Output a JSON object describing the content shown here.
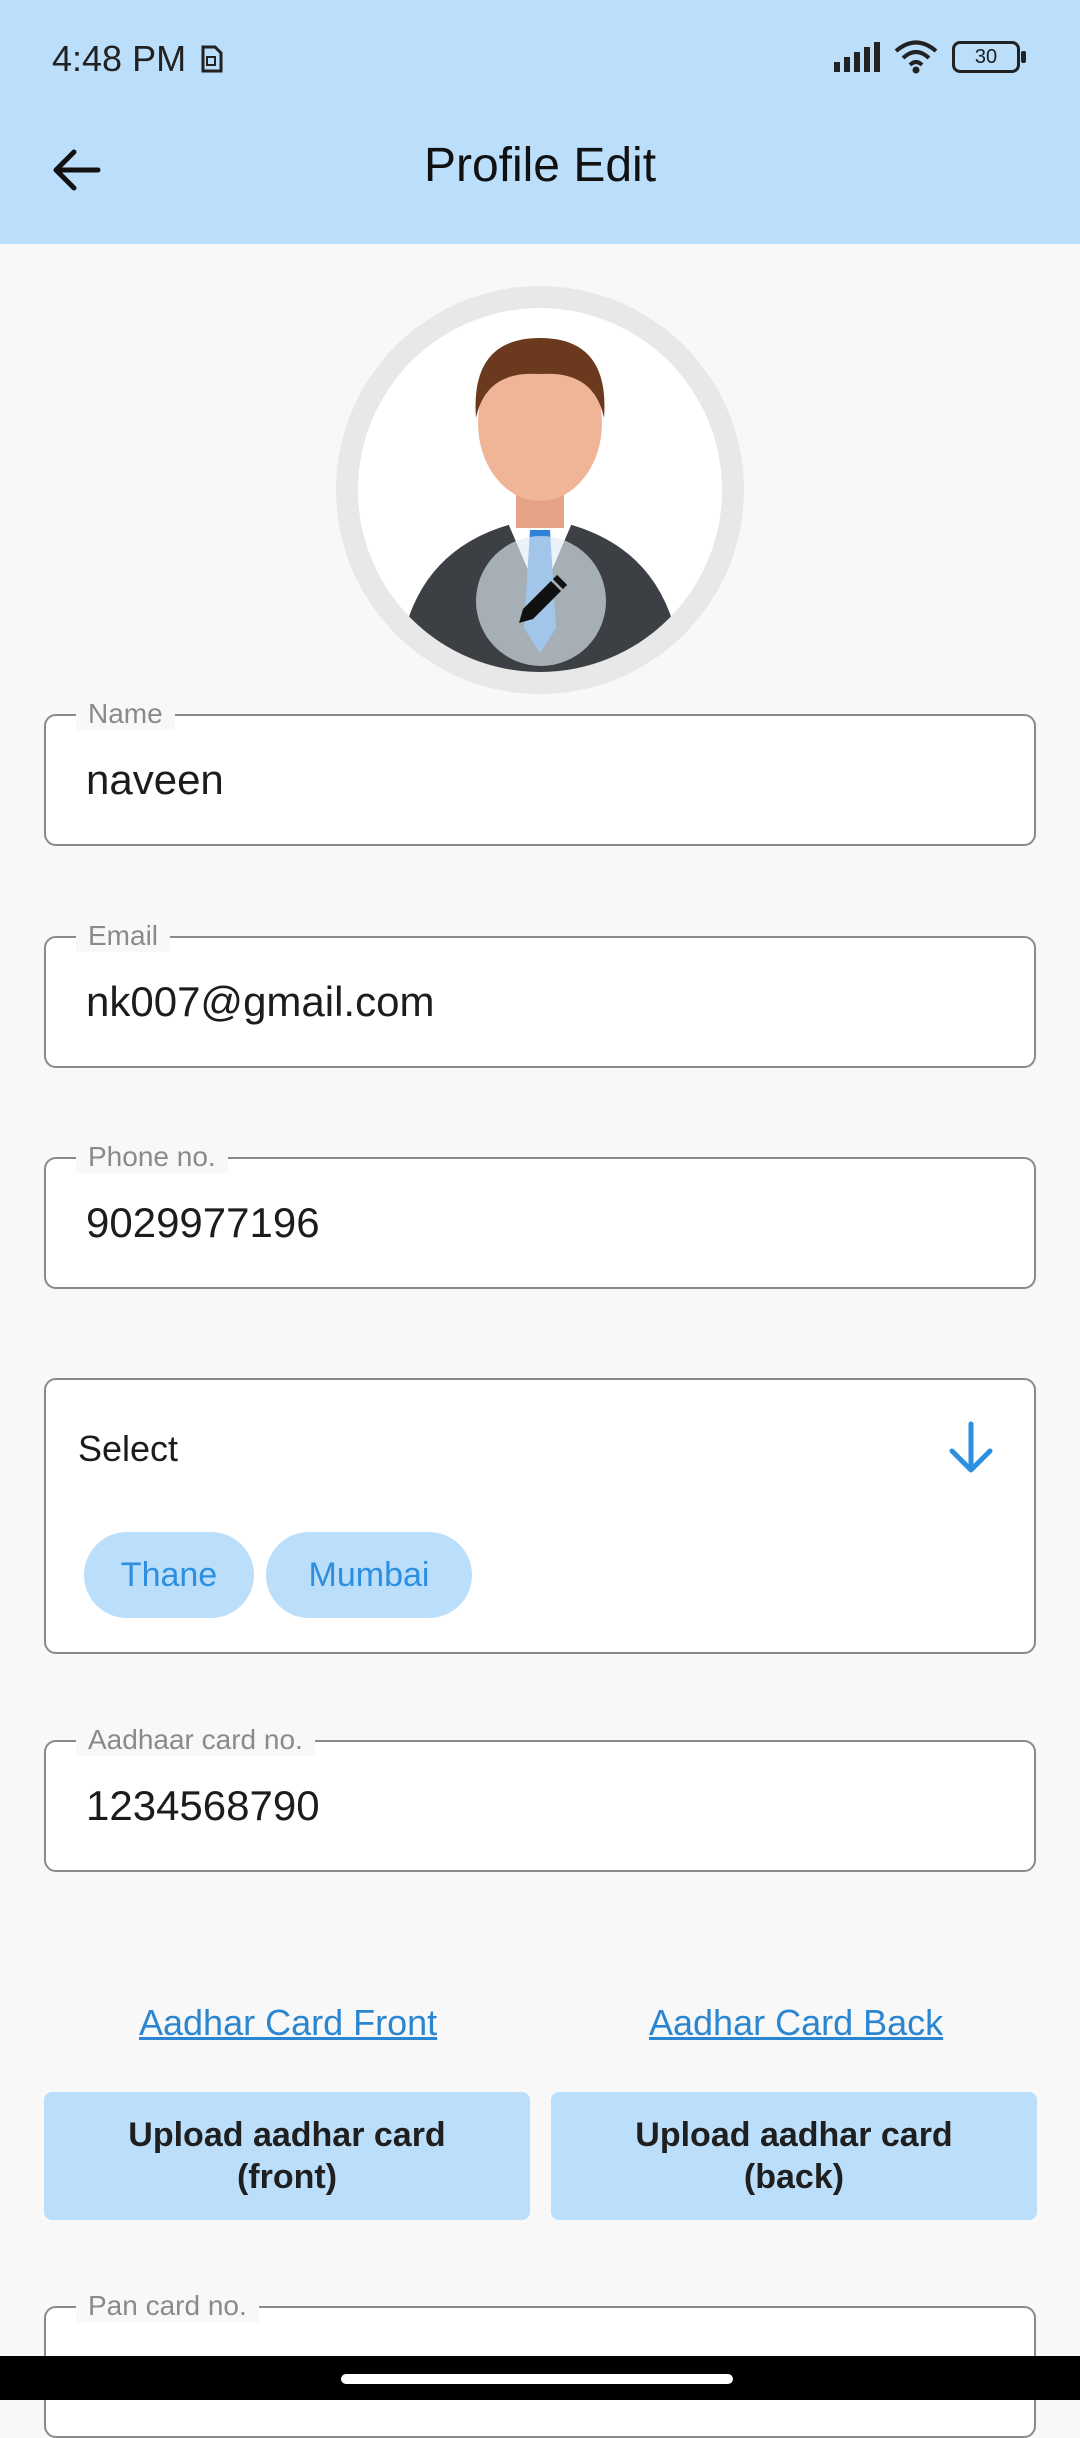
{
  "status_bar": {
    "time": "4:48 PM",
    "battery": "30",
    "icons": [
      "sim-icon",
      "signal-icon",
      "wifi-icon",
      "battery-icon"
    ]
  },
  "header": {
    "title": "Profile Edit",
    "back_icon": "back-arrow-icon"
  },
  "avatar": {
    "edit_icon": "pencil-icon"
  },
  "fields": {
    "name": {
      "label": "Name",
      "value": "naveen"
    },
    "email": {
      "label": "Email",
      "value": "nk007@gmail.com"
    },
    "phone": {
      "label": "Phone no.",
      "value": "9029977196"
    },
    "aadhaar": {
      "label": "Aadhaar card no.",
      "value": "1234568790"
    },
    "pan": {
      "label": "Pan card no.",
      "value": ""
    }
  },
  "select": {
    "label": "Select",
    "chips": [
      "Thane",
      "Mumbai"
    ]
  },
  "aadhar_links": {
    "front": "Aadhar Card Front",
    "back": "Aadhar Card Back"
  },
  "upload_buttons": {
    "front": "Upload aadhar card\n(front)",
    "back": "Upload aadhar card\n(back)"
  },
  "colors": {
    "header_bg": "#bbdefb",
    "accent": "#2a86d1",
    "chip_bg": "#bbdefb"
  }
}
